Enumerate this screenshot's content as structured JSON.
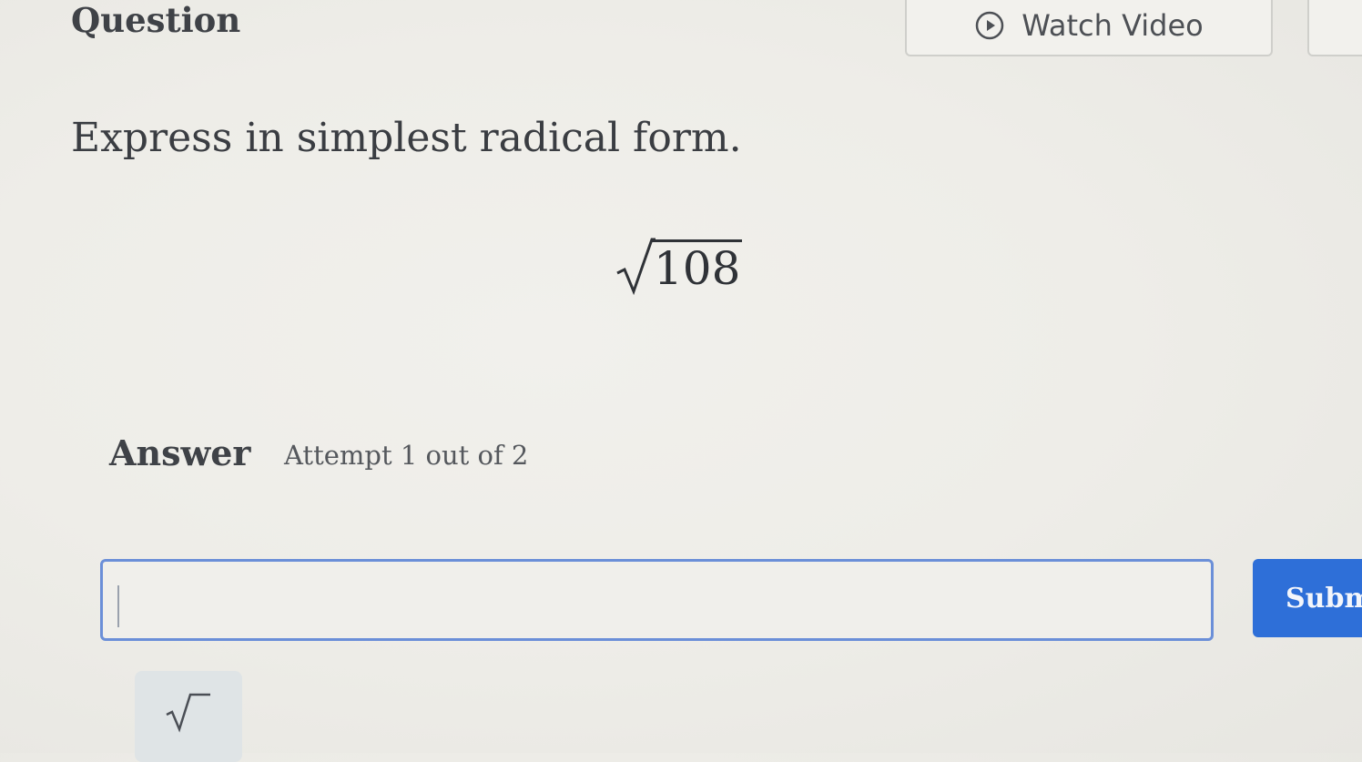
{
  "header": {
    "title": "Question",
    "watch_video_label": "Watch Video"
  },
  "question": {
    "prompt": "Express in simplest radical form.",
    "radicand": "108"
  },
  "answer": {
    "label": "Answer",
    "attempt": "Attempt 1 out of 2",
    "input_value": "",
    "submit_label": "Submit"
  },
  "icons": {
    "play": "play-circle-icon",
    "radical": "square-root-icon"
  },
  "colors": {
    "accent": "#2e6fd8",
    "input_border": "#6b8fd8"
  }
}
